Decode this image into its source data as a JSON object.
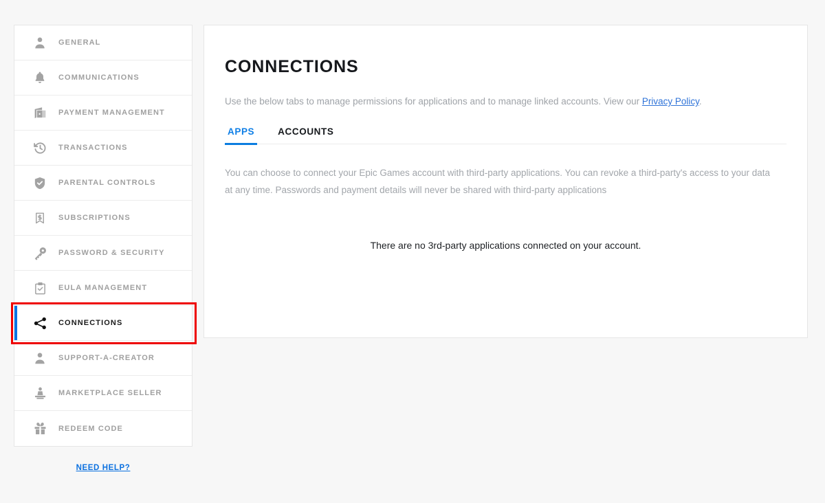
{
  "sidebar": {
    "items": [
      {
        "label": "GENERAL",
        "icon": "person-icon",
        "active": false
      },
      {
        "label": "COMMUNICATIONS",
        "icon": "bell-icon",
        "active": false
      },
      {
        "label": "PAYMENT MANAGEMENT",
        "icon": "wallet-icon",
        "active": false
      },
      {
        "label": "TRANSACTIONS",
        "icon": "history-icon",
        "active": false
      },
      {
        "label": "PARENTAL CONTROLS",
        "icon": "shield-check-icon",
        "active": false
      },
      {
        "label": "SUBSCRIPTIONS",
        "icon": "dollar-tag-icon",
        "active": false
      },
      {
        "label": "PASSWORD & SECURITY",
        "icon": "key-icon",
        "active": false
      },
      {
        "label": "EULA MANAGEMENT",
        "icon": "clipboard-check-icon",
        "active": false
      },
      {
        "label": "CONNECTIONS",
        "icon": "share-icon",
        "active": true
      },
      {
        "label": "SUPPORT-A-CREATOR",
        "icon": "person-icon",
        "active": false
      },
      {
        "label": "MARKETPLACE SELLER",
        "icon": "podium-icon",
        "active": false
      },
      {
        "label": "REDEEM CODE",
        "icon": "gift-icon",
        "active": false
      }
    ],
    "need_help_label": "NEED HELP?"
  },
  "main": {
    "title": "CONNECTIONS",
    "intro_before_link": "Use the below tabs to manage permissions for applications and to manage linked accounts. View our ",
    "intro_link": "Privacy Policy",
    "intro_after_link": ".",
    "tabs": [
      {
        "label": "APPS",
        "active": true
      },
      {
        "label": "ACCOUNTS",
        "active": false
      }
    ],
    "body_copy": "You can choose to connect your Epic Games account with third-party applications. You can revoke a third-party's access to your data at any time. Passwords and payment details will never be shared with third-party applications",
    "empty_state": "There are no 3rd-party applications connected on your account."
  },
  "colors": {
    "accent_blue": "#0b7de0",
    "link_blue": "#2f73d8",
    "highlight_red": "#ee0000",
    "page_background": "#f7f7f7",
    "panel_background": "#ffffff",
    "muted_text": "#a0a0a0"
  }
}
